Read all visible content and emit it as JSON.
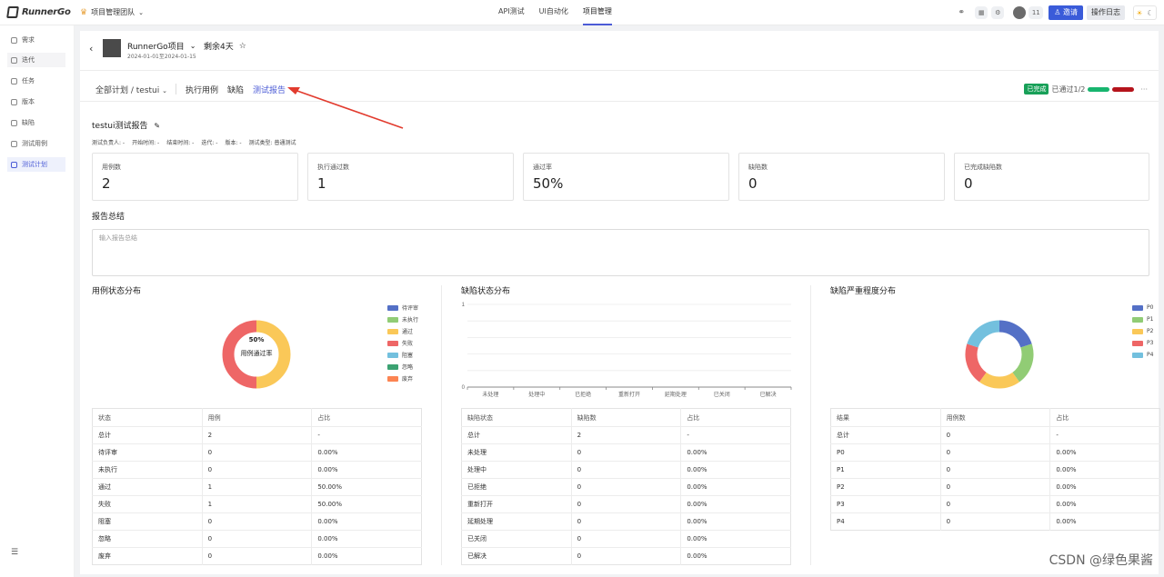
{
  "topbar": {
    "brand": "RunnerGo",
    "team": "项目管理团队",
    "nav": [
      {
        "label": "API测试"
      },
      {
        "label": "UI自动化"
      },
      {
        "label": "项目管理"
      }
    ],
    "member_count": "11",
    "invite_label": "邀请",
    "oplog_label": "操作日志"
  },
  "sidebar": {
    "items": [
      {
        "label": "需求",
        "icon": "target-icon"
      },
      {
        "label": "迭代",
        "icon": "iteration-icon"
      },
      {
        "label": "任务",
        "icon": "task-icon"
      },
      {
        "label": "版本",
        "icon": "version-icon"
      },
      {
        "label": "缺陷",
        "icon": "bug-icon"
      },
      {
        "label": "测试用例",
        "icon": "testcase-icon"
      },
      {
        "label": "测试计划",
        "icon": "testplan-icon"
      }
    ]
  },
  "project": {
    "name": "RunnerGo项目",
    "dates": "2024-01-01至2024-01-15",
    "remaining": "剩余4天"
  },
  "subnav": {
    "plan": "全部计划 / testui",
    "tabs": [
      {
        "label": "执行用例"
      },
      {
        "label": "缺陷"
      },
      {
        "label": "测试报告"
      }
    ],
    "status": "已完成",
    "passed": "已通过1/2",
    "bar_colors": [
      "#18b56f",
      "#b5141c"
    ]
  },
  "report": {
    "title": "testui测试报告",
    "meta": [
      "测试负责人: -",
      "开始时间: -",
      "结束时间: -",
      "迭代: -",
      "版本: -",
      "测试类型: 普通测试"
    ],
    "stats": [
      {
        "label": "用例数",
        "value": "2"
      },
      {
        "label": "执行通过数",
        "value": "1"
      },
      {
        "label": "通过率",
        "value": "50%"
      },
      {
        "label": "缺陷数",
        "value": "0"
      },
      {
        "label": "已完成缺陷数",
        "value": "0"
      }
    ],
    "summary_label": "报告总结",
    "summary_placeholder": "输入报告总结"
  },
  "case_dist": {
    "title": "用例状态分布",
    "center_value": "50%",
    "center_label": "用例通过率",
    "legend": [
      {
        "label": "待评审",
        "color": "#5470c6"
      },
      {
        "label": "未执行",
        "color": "#91cc75"
      },
      {
        "label": "通过",
        "color": "#fac858"
      },
      {
        "label": "失败",
        "color": "#ee6666"
      },
      {
        "label": "阻塞",
        "color": "#73c0de"
      },
      {
        "label": "忽略",
        "color": "#3ba272"
      },
      {
        "label": "废弃",
        "color": "#fc8452"
      }
    ],
    "table": {
      "headers": [
        "状态",
        "用例",
        "占比"
      ],
      "rows": [
        [
          "总计",
          "2",
          "-"
        ],
        [
          "待评审",
          "0",
          "0.00%"
        ],
        [
          "未执行",
          "0",
          "0.00%"
        ],
        [
          "通过",
          "1",
          "50.00%"
        ],
        [
          "失败",
          "1",
          "50.00%"
        ],
        [
          "阻塞",
          "0",
          "0.00%"
        ],
        [
          "忽略",
          "0",
          "0.00%"
        ],
        [
          "废弃",
          "0",
          "0.00%"
        ]
      ]
    }
  },
  "bug_dist": {
    "title": "缺陷状态分布",
    "table": {
      "headers": [
        "缺陷状态",
        "缺陷数",
        "占比"
      ],
      "rows": [
        [
          "总计",
          "2",
          "-"
        ],
        [
          "未处理",
          "0",
          "0.00%"
        ],
        [
          "处理中",
          "0",
          "0.00%"
        ],
        [
          "已拒绝",
          "0",
          "0.00%"
        ],
        [
          "重新打开",
          "0",
          "0.00%"
        ],
        [
          "延期处理",
          "0",
          "0.00%"
        ],
        [
          "已关闭",
          "0",
          "0.00%"
        ],
        [
          "已解决",
          "0",
          "0.00%"
        ]
      ]
    }
  },
  "severity_dist": {
    "title": "缺陷严重程度分布",
    "legend": [
      {
        "label": "P0",
        "color": "#5470c6"
      },
      {
        "label": "P1",
        "color": "#91cc75"
      },
      {
        "label": "P2",
        "color": "#fac858"
      },
      {
        "label": "P3",
        "color": "#ee6666"
      },
      {
        "label": "P4",
        "color": "#73c0de"
      }
    ],
    "table": {
      "headers": [
        "结果",
        "用例数",
        "占比"
      ],
      "rows": [
        [
          "总计",
          "0",
          "-"
        ],
        [
          "P0",
          "0",
          "0.00%"
        ],
        [
          "P1",
          "0",
          "0.00%"
        ],
        [
          "P2",
          "0",
          "0.00%"
        ],
        [
          "P3",
          "0",
          "0.00%"
        ],
        [
          "P4",
          "0",
          "0.00%"
        ]
      ]
    }
  },
  "chart_data": [
    {
      "type": "pie",
      "title": "用例状态分布",
      "categories": [
        "待评审",
        "未执行",
        "通过",
        "失败",
        "阻塞",
        "忽略",
        "废弃"
      ],
      "values": [
        0,
        0,
        1,
        1,
        0,
        0,
        0
      ],
      "legend": "right"
    },
    {
      "type": "bar",
      "title": "缺陷状态分布",
      "categories": [
        "未处理",
        "处理中",
        "已拒绝",
        "重新打开",
        "延期处理",
        "已关闭",
        "已解决"
      ],
      "values": [
        0,
        0,
        0,
        0,
        0,
        0,
        0
      ],
      "ylim": [
        0,
        1
      ],
      "yticks": [
        "0",
        "1"
      ]
    },
    {
      "type": "pie",
      "title": "缺陷严重程度分布",
      "categories": [
        "P0",
        "P1",
        "P2",
        "P3",
        "P4"
      ],
      "values": [
        1,
        1,
        1,
        1,
        1
      ],
      "legend": "right"
    }
  ],
  "watermark": "CSDN @绿色果酱"
}
